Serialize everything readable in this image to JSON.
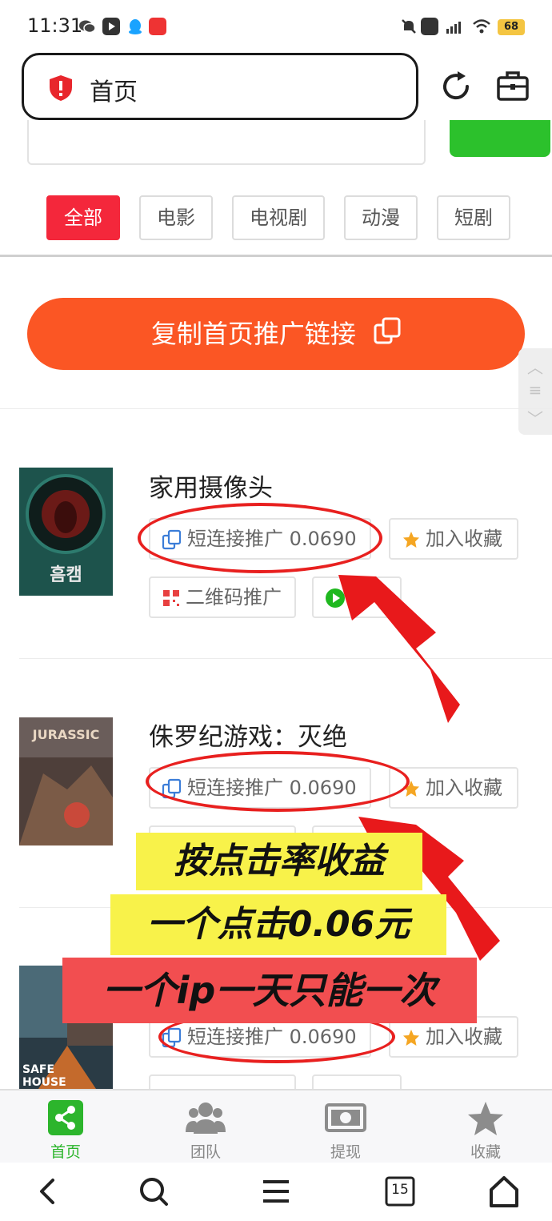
{
  "status_bar": {
    "time": "11:31",
    "battery": "68"
  },
  "browser": {
    "address_text": "首页"
  },
  "categories": [
    {
      "label": "全部",
      "active": true
    },
    {
      "label": "电影",
      "active": false
    },
    {
      "label": "电视剧",
      "active": false
    },
    {
      "label": "动漫",
      "active": false
    },
    {
      "label": "短剧",
      "active": false
    }
  ],
  "promo": {
    "copy_home_link": "复制首页推广链接"
  },
  "items": [
    {
      "title": "家用摄像头",
      "short_link": "短连接推广 0.0690",
      "favorite": "加入收藏",
      "qrcode": "二维码推广"
    },
    {
      "title": "侏罗纪游戏：灭绝",
      "short_link": "短连接推广 0.0690",
      "favorite": "加入收藏"
    },
    {
      "short_link": "短连接推广 0.0690",
      "favorite": "加入收藏"
    }
  ],
  "posters": {
    "poster1_text": "흠캠",
    "poster2_text": "JURASSIC",
    "poster3_text": "SAFE HOUSE"
  },
  "overlay": {
    "line1": "按点击率收益",
    "line2": "一个点击0.06元",
    "line3": "一个ip一天只能一次"
  },
  "bottom_nav": [
    {
      "label": "首页",
      "active": true
    },
    {
      "label": "团队",
      "active": false
    },
    {
      "label": "提现",
      "active": false
    },
    {
      "label": "收藏",
      "active": false
    }
  ],
  "system_nav": {
    "tabs_count": "15"
  },
  "colors": {
    "accent_red": "#f4273b",
    "promo_orange": "#fb5624",
    "nav_green": "#2cb52c",
    "highlight_yellow": "#f8f24a"
  }
}
